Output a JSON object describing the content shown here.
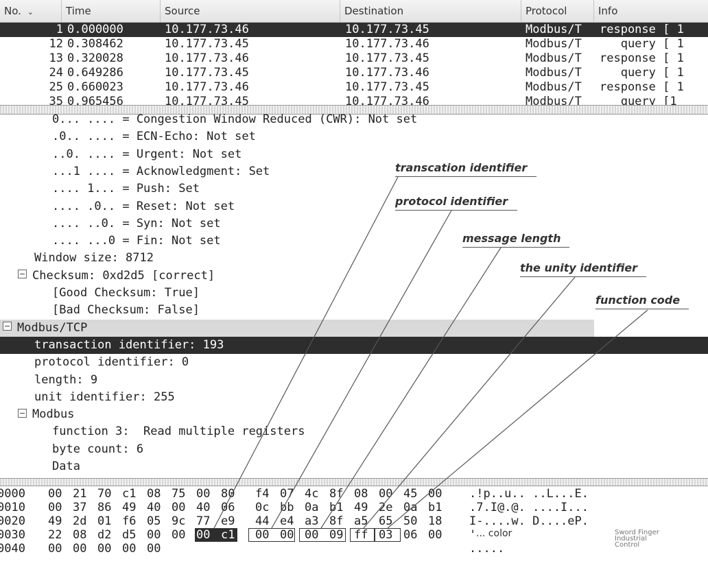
{
  "columns": [
    {
      "label": "No.",
      "arrow": "⌄"
    },
    {
      "label": "Time"
    },
    {
      "label": "Source"
    },
    {
      "label": "Destination"
    },
    {
      "label": "Protocol"
    },
    {
      "label": "Info"
    }
  ],
  "packets": [
    {
      "no": "1",
      "time": "0.000000",
      "source": "10.177.73.46",
      "destination": "10.177.73.45",
      "protocol": "Modbus/T",
      "info": "response [ 1",
      "selected": true
    },
    {
      "no": "12",
      "time": "0.308462",
      "source": "10.177.73.45",
      "destination": "10.177.73.46",
      "protocol": "Modbus/T",
      "info": "   query [ 1",
      "selected": false
    },
    {
      "no": "13",
      "time": "0.320028",
      "source": "10.177.73.46",
      "destination": "10.177.73.45",
      "protocol": "Modbus/T",
      "info": "response [ 1",
      "selected": false
    },
    {
      "no": "24",
      "time": "0.649286",
      "source": "10.177.73.45",
      "destination": "10.177.73.46",
      "protocol": "Modbus/T",
      "info": "   query [ 1",
      "selected": false
    },
    {
      "no": "25",
      "time": "0.660023",
      "source": "10.177.73.46",
      "destination": "10.177.73.45",
      "protocol": "Modbus/T",
      "info": "response [ 1",
      "selected": false
    },
    {
      "no": "35",
      "time": "0.965456",
      "source": "10.177.73.45",
      "destination": "10.177.73.46",
      "protocol": "Modbus/T",
      "info": "   query [1",
      "selected": false
    }
  ],
  "details": [
    {
      "text": "0... .... = Congestion Window Reduced (CWR): Not set",
      "indent": 1
    },
    {
      "text": ".0.. .... = ECN-Echo: Not set",
      "indent": 1
    },
    {
      "text": "..0. .... = Urgent: Not set",
      "indent": 1
    },
    {
      "text": "...1 .... = Acknowledgment: Set",
      "indent": 1
    },
    {
      "text": ".... 1... = Push: Set",
      "indent": 1
    },
    {
      "text": ".... .0.. = Reset: Not set",
      "indent": 1
    },
    {
      "text": ".... ..0. = Syn: Not set",
      "indent": 1
    },
    {
      "text": ".... ...0 = Fin: Not set",
      "indent": 1
    },
    {
      "text": "Window size: 8712",
      "indent": 0
    },
    {
      "text": "Checksum: 0xd2d5 [correct]",
      "indent": 0,
      "expander": true
    },
    {
      "text": "[Good Checksum: True]",
      "indent": 1
    },
    {
      "text": "[Bad Checksum: False]",
      "indent": 1
    },
    {
      "text": "Modbus/TCP",
      "indent": -1,
      "expander": true,
      "style": "grey"
    },
    {
      "text": "transaction identifier: 193",
      "indent": 0,
      "style": "highlight"
    },
    {
      "text": "protocol identifier: 0",
      "indent": 0
    },
    {
      "text": "length: 9",
      "indent": 0
    },
    {
      "text": "unit identifier: 255",
      "indent": 0
    },
    {
      "text": "Modbus",
      "indent": 0,
      "expander": true
    },
    {
      "text": "function 3:  Read multiple registers",
      "indent": 1
    },
    {
      "text": "byte count: 6",
      "indent": 1
    },
    {
      "text": "Data",
      "indent": 1
    }
  ],
  "hex_rows": [
    {
      "offset": "0000",
      "bytes": [
        "00",
        "21",
        "70",
        "c1",
        "08",
        "75",
        "00",
        "80",
        "f4",
        "07",
        "4c",
        "8f",
        "08",
        "00",
        "45",
        "00"
      ],
      "ascii": ".!p..u.. ..L...E."
    },
    {
      "offset": "0010",
      "bytes": [
        "00",
        "37",
        "86",
        "49",
        "40",
        "00",
        "40",
        "06",
        "0c",
        "bb",
        "0a",
        "b1",
        "49",
        "2e",
        "0a",
        "b1"
      ],
      "ascii": ".7.I@.@. ....I..."
    },
    {
      "offset": "0020",
      "bytes": [
        "49",
        "2d",
        "01",
        "f6",
        "05",
        "9c",
        "77",
        "e9",
        "44",
        "e4",
        "a3",
        "8f",
        "a5",
        "65",
        "50",
        "18"
      ],
      "ascii": "I-....w. D....eP."
    },
    {
      "offset": "0030",
      "bytes": [
        "22",
        "08",
        "d2",
        "d5",
        "00",
        "00",
        "00",
        "c1",
        "00",
        "00",
        "00",
        "09",
        "ff",
        "03",
        "06",
        "00"
      ],
      "ascii": "'"
    },
    {
      "offset": "0040",
      "bytes": [
        "00",
        "00",
        "00",
        "00",
        "00"
      ],
      "ascii": "....."
    }
  ],
  "annotations": [
    {
      "label": "transcation identifier"
    },
    {
      "label": "protocol identifier"
    },
    {
      "label": "message length"
    },
    {
      "label": "the unity identifier"
    },
    {
      "label": "function code"
    }
  ],
  "color_text": "... color",
  "watermark": [
    "Sword Finger",
    "Industrial",
    "Control"
  ]
}
